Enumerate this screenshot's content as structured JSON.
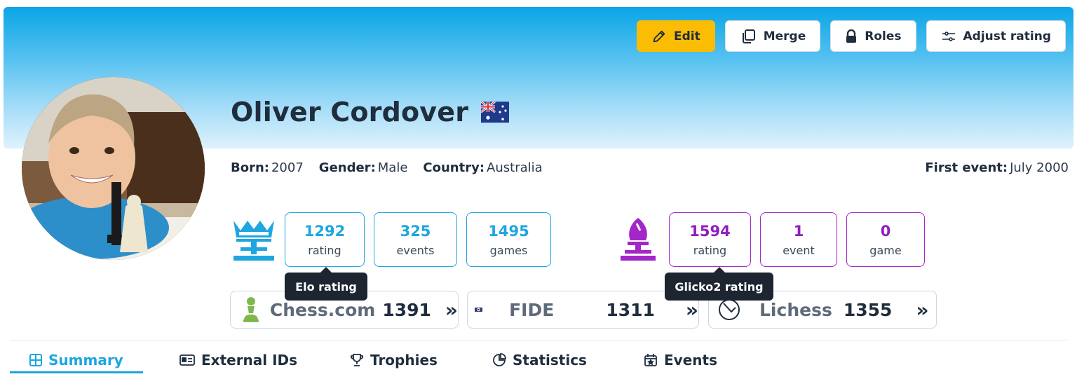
{
  "actions": {
    "edit": "Edit",
    "merge": "Merge",
    "roles": "Roles",
    "adjust": "Adjust rating"
  },
  "player": {
    "name": "Oliver Cordover",
    "flag_icon": "australia-flag-icon",
    "born_label": "Born:",
    "born": "2007",
    "gender_label": "Gender:",
    "gender": "Male",
    "country_label": "Country:",
    "country": "Australia",
    "first_event_label": "First event:",
    "first_event": "July 2000"
  },
  "elo": {
    "icon": "crown-pawn-icon",
    "color": "#1ea6e0",
    "rating": "1292",
    "rating_label": "rating",
    "events": "325",
    "events_label": "events",
    "games": "1495",
    "games_label": "games",
    "tooltip": "Elo rating"
  },
  "glicko": {
    "icon": "bishop-icon",
    "color": "#a326c9",
    "rating": "1594",
    "rating_label": "rating",
    "events": "1",
    "events_label": "event",
    "games": "0",
    "games_label": "game",
    "tooltip": "Glicko2 rating"
  },
  "platforms": [
    {
      "name": "Chess.com",
      "rating": "1391",
      "icon": "chesscom-pawn-icon"
    },
    {
      "name": "FIDE",
      "rating": "1311",
      "icon": "fide-logo-icon"
    },
    {
      "name": "Lichess",
      "rating": "1355",
      "icon": "lichess-horse-icon"
    }
  ],
  "tabs": [
    {
      "label": "Summary",
      "icon": "grid-icon",
      "active": true
    },
    {
      "label": "External IDs",
      "icon": "id-card-icon"
    },
    {
      "label": "Trophies",
      "icon": "trophy-icon"
    },
    {
      "label": "Statistics",
      "icon": "pie-chart-icon"
    },
    {
      "label": "Events",
      "icon": "calendar-icon"
    }
  ]
}
